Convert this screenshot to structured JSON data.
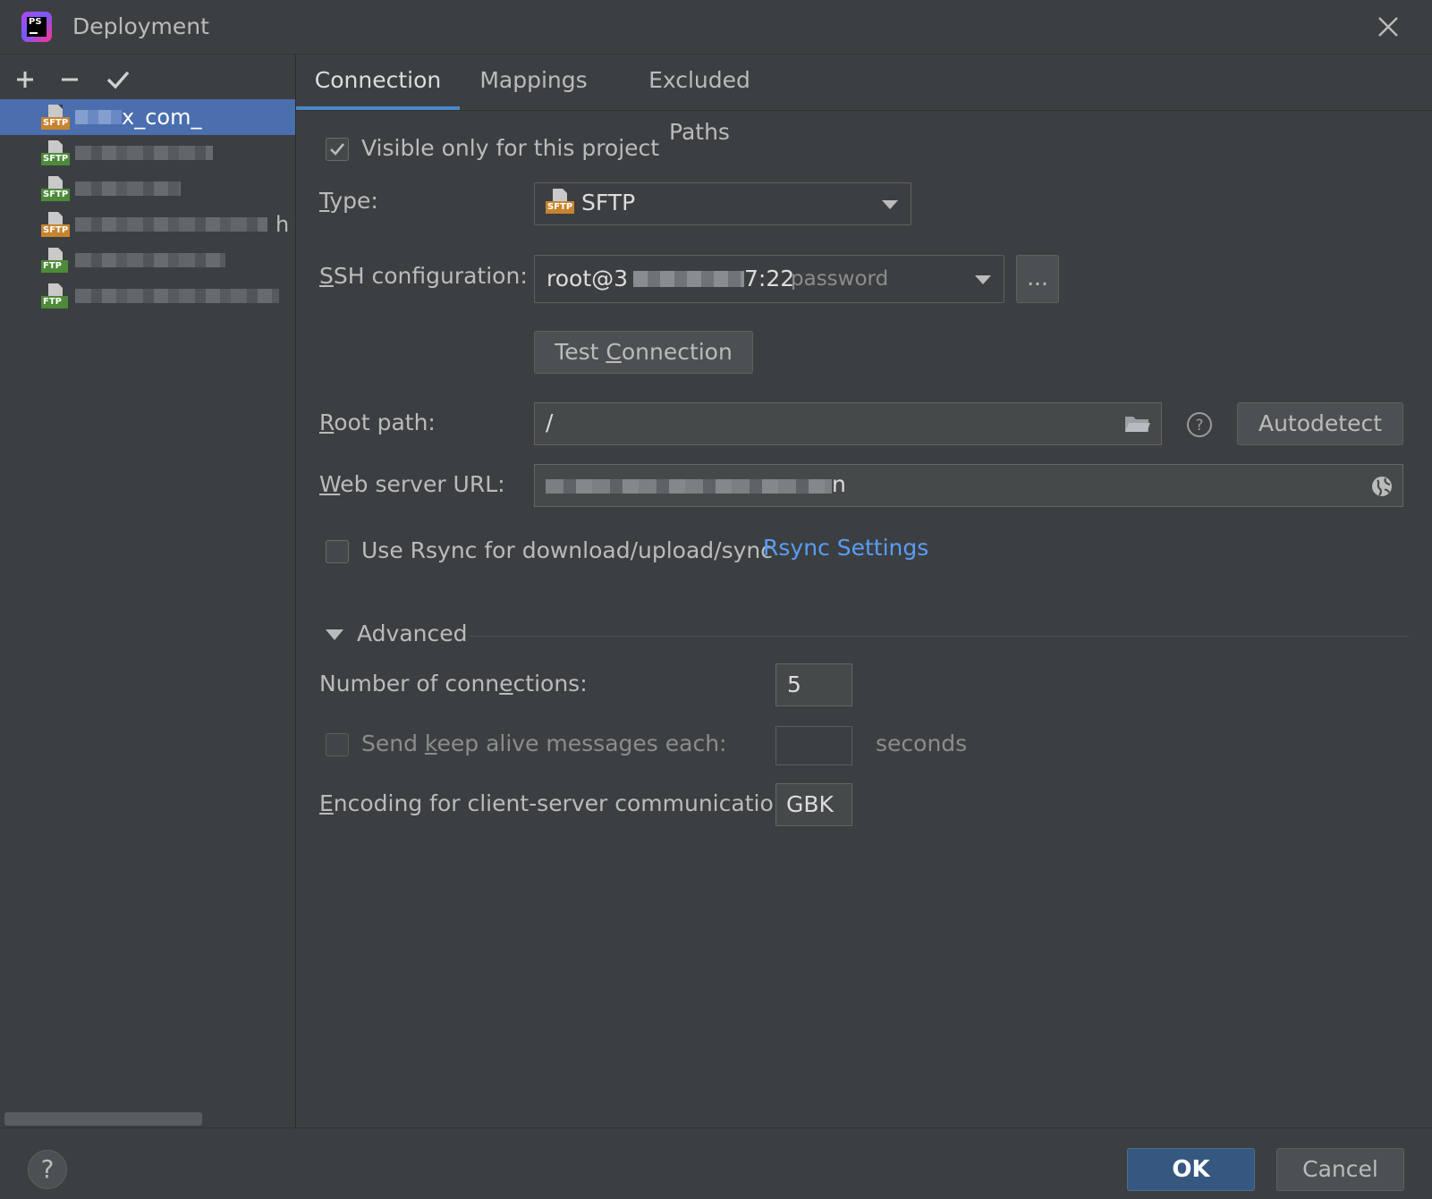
{
  "window": {
    "title": "Deployment",
    "app_logo_text": "PS"
  },
  "toolbar": {
    "add_icon": "plus-icon",
    "remove_icon": "minus-icon",
    "default_icon": "check-icon"
  },
  "servers": [
    {
      "name": "x_com_",
      "tag": "SFTP",
      "selected": true
    },
    {
      "name": "",
      "tag": "SFTP",
      "selected": false
    },
    {
      "name": "",
      "tag": "SFTP",
      "selected": false
    },
    {
      "name": "h",
      "tag": "SFTP",
      "selected": false
    },
    {
      "name": "",
      "tag": "FTP",
      "selected": false
    },
    {
      "name": "",
      "tag": "FTP",
      "selected": false
    }
  ],
  "tabs": [
    "Connection",
    "Mappings",
    "Excluded Paths"
  ],
  "form": {
    "visible_only": {
      "label": "Visible only for this project",
      "checked": true
    },
    "type": {
      "label": "Type:",
      "value": "SFTP",
      "tag": "SFTP"
    },
    "ssh": {
      "label": "SSH configuration:",
      "value_prefix": "root@3",
      "value_suffix": "7:22",
      "hint": "password",
      "more": "..."
    },
    "test_connection": "Test Connection",
    "root_path": {
      "label": "Root path:",
      "value": "/",
      "autodetect": "Autodetect"
    },
    "web_url": {
      "label": "Web server URL:",
      "value_tail": "n"
    },
    "rsync": {
      "label": "Use Rsync for download/upload/sync",
      "checked": false,
      "link": "Rsync Settings"
    },
    "advanced": {
      "title": "Advanced",
      "connections": {
        "label": "Number of connections:",
        "value": "5"
      },
      "keep_alive": {
        "label": "Send keep alive messages each:",
        "checked": false,
        "value": "",
        "unit": "seconds"
      },
      "encoding": {
        "label": "Encoding for client-server communication:",
        "value": "GBK"
      }
    }
  },
  "footer": {
    "help": "?",
    "ok": "OK",
    "cancel": "Cancel"
  },
  "colors": {
    "background": "#3c3f41",
    "selection": "#4b6eaf",
    "tab_underline": "#4a88c7",
    "link": "#589df6",
    "ok_button": "#365880"
  }
}
